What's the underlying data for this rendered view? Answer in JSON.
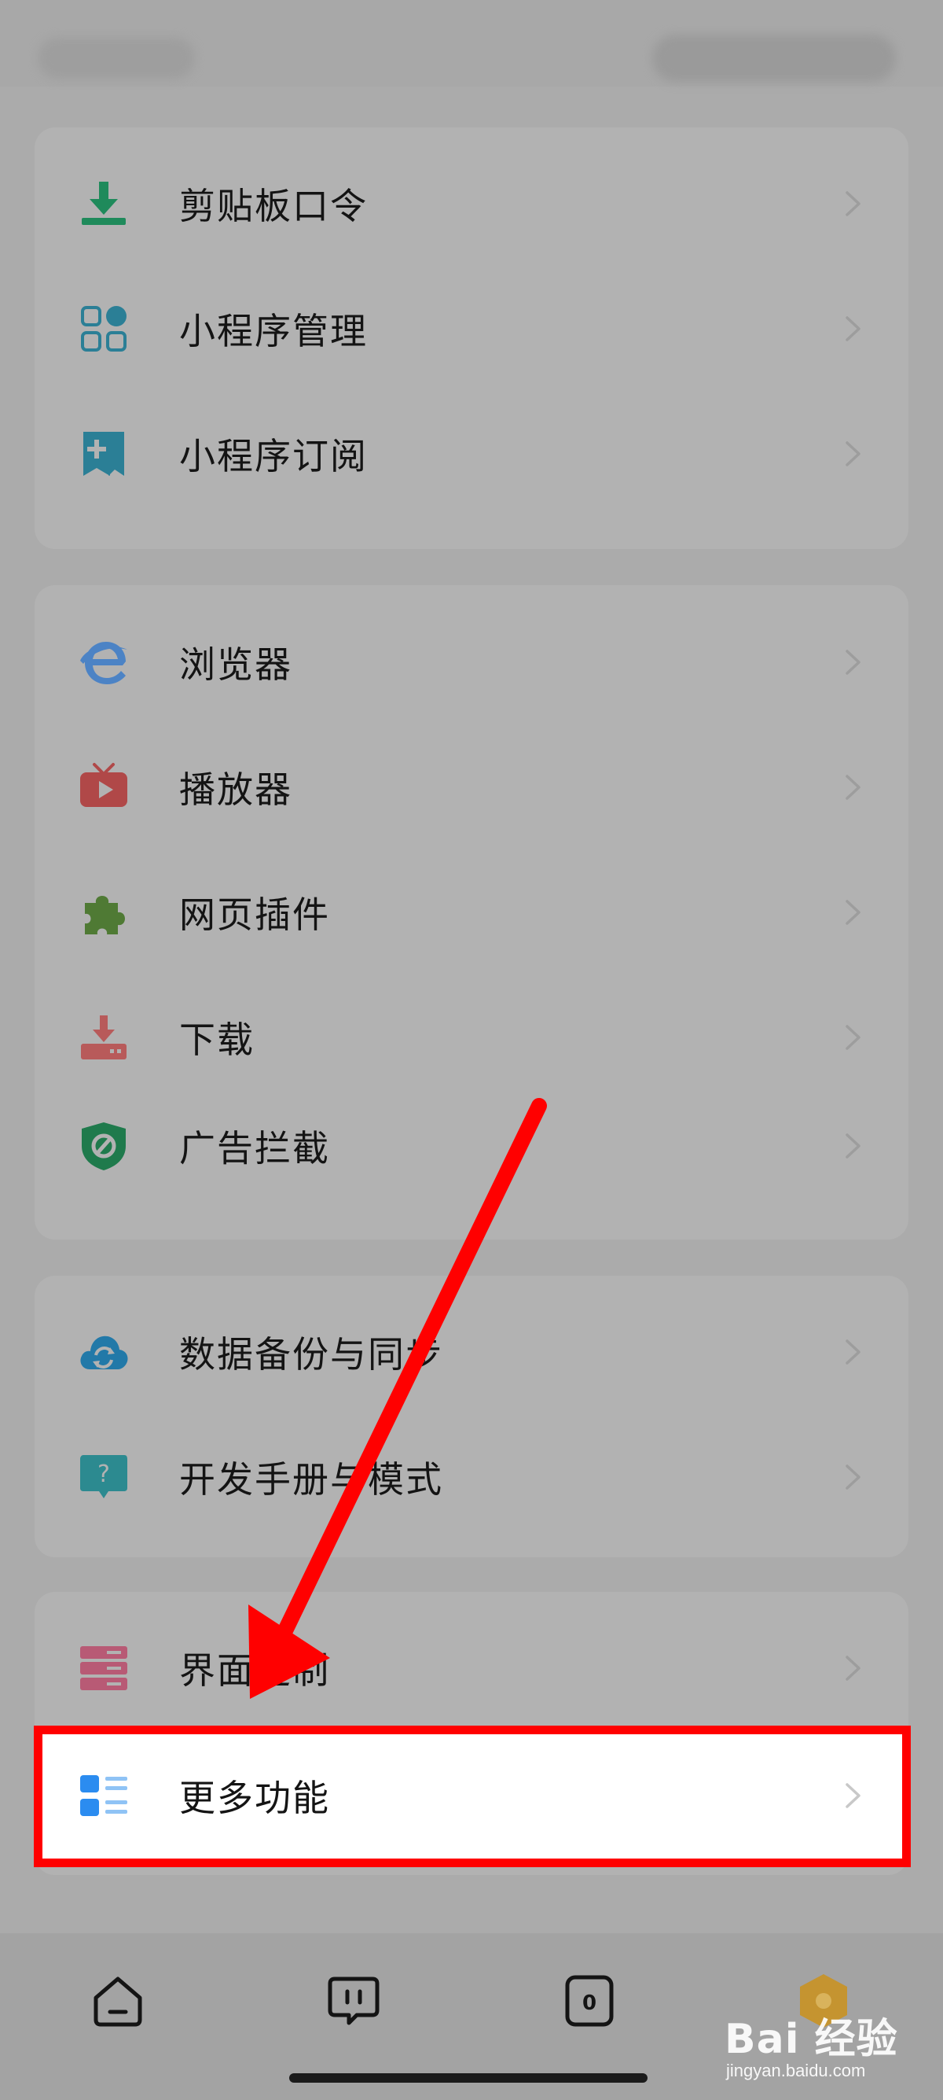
{
  "groups": [
    {
      "items": [
        {
          "label": "剪贴板口令",
          "icon": "clipboard-download-icon"
        },
        {
          "label": "小程序管理",
          "icon": "grid-apps-icon"
        },
        {
          "label": "小程序订阅",
          "icon": "bookmark-plus-icon"
        }
      ]
    },
    {
      "items": [
        {
          "label": "浏览器",
          "icon": "browser-e-icon"
        },
        {
          "label": "播放器",
          "icon": "tv-play-icon"
        },
        {
          "label": "网页插件",
          "icon": "puzzle-icon"
        },
        {
          "label": "下载",
          "icon": "download-tray-icon"
        },
        {
          "label": "广告拦截",
          "icon": "shield-block-icon"
        }
      ]
    },
    {
      "items": [
        {
          "label": "数据备份与同步",
          "icon": "cloud-sync-icon"
        },
        {
          "label": "开发手册与模式",
          "icon": "help-bubble-icon"
        }
      ]
    },
    {
      "items": [
        {
          "label": "界面定制",
          "icon": "server-stack-icon"
        },
        {
          "label": "更多功能",
          "icon": "list-more-icon"
        }
      ]
    }
  ],
  "bottom_nav": [
    "home-icon",
    "chat-bubble-icon",
    "tabs-count-icon",
    "profile-avatar-icon"
  ],
  "tabs_count": "0",
  "watermark": {
    "brand": "Bai 经验",
    "url": "jingyan.baidu.com"
  },
  "colors": {
    "highlight_border": "#ff0000",
    "arrow": "#ff0000"
  }
}
